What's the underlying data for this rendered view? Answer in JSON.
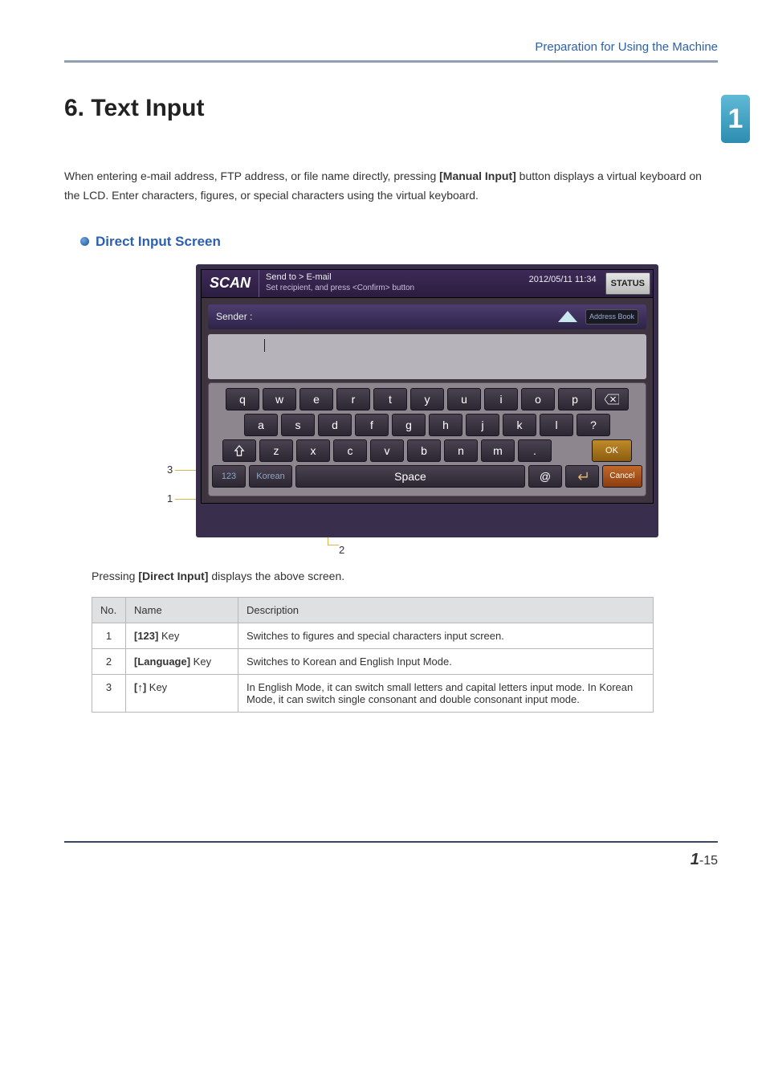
{
  "header": {
    "section": "Preparation for Using the Machine"
  },
  "chapter_tab": "1",
  "title": "6. Text Input",
  "intro": {
    "pre": "When entering e-mail address, FTP address, or file name directly, pressing ",
    "bold": "[Manual Input]",
    "post": " button displays a virtual keyboard on the LCD. Enter characters, figures, or special characters using the virtual keyboard."
  },
  "subheading": "Direct Input Screen",
  "shot": {
    "scan": "SCAN",
    "breadcrumb": "Send to > E-mail",
    "breadcrumb_sub": "Set recipient, and press <Confirm> button",
    "timestamp": "2012/05/11 11:34",
    "status": "STATUS",
    "sender_label": "Sender :",
    "address_book": "Address Book",
    "row1": [
      "q",
      "w",
      "e",
      "r",
      "t",
      "y",
      "u",
      "i",
      "o",
      "p"
    ],
    "row2": [
      "a",
      "s",
      "d",
      "f",
      "g",
      "h",
      "j",
      "k",
      "l",
      "?"
    ],
    "row3": [
      "z",
      "x",
      "c",
      "v",
      "b",
      "n",
      "m",
      "."
    ],
    "num_key": "123",
    "lang_key": "Korean",
    "space": "Space",
    "at": "@",
    "ok": "OK",
    "cancel": "Cancel"
  },
  "callouts": {
    "c1": "1",
    "c2": "2",
    "c3": "3"
  },
  "para": {
    "pre": "Pressing ",
    "bold": "[Direct Input]",
    "post": " displays the above screen."
  },
  "table": {
    "headers": {
      "no": "No.",
      "name": "Name",
      "desc": "Description"
    },
    "rows": [
      {
        "no": "1",
        "name_bold": "[123]",
        "name_rest": " Key",
        "desc": "Switches to figures and special characters input screen."
      },
      {
        "no": "2",
        "name_bold": "[Language]",
        "name_rest": " Key",
        "desc": "Switches to Korean and English Input Mode."
      },
      {
        "no": "3",
        "name_bold": "[↑]",
        "name_rest": " Key",
        "desc": "In English Mode, it can switch small letters and capital letters input mode. In Korean Mode, it can switch single consonant and double consonant input mode."
      }
    ]
  },
  "footer": {
    "chapter": "1",
    "sep": "-",
    "page": "15"
  }
}
